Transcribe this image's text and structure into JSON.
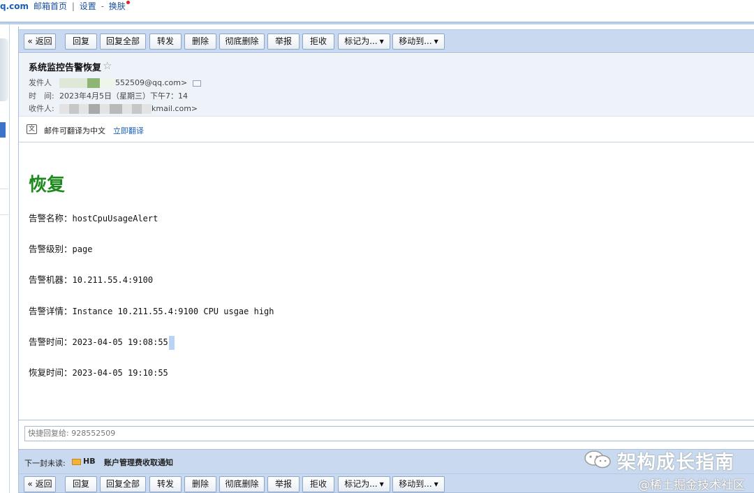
{
  "topbar": {
    "logo_fragment": "q.com",
    "links": [
      "邮箱首页",
      "设置",
      "换肤"
    ],
    "sep1": "|",
    "sep2": "-"
  },
  "toolbar": {
    "back": "« 返回",
    "reply": "回复",
    "reply_all": "回复全部",
    "forward": "转发",
    "delete": "删除",
    "delete_permanent": "彻底删除",
    "report": "举报",
    "reject": "拒收",
    "mark_as": "标记为...",
    "move_to": "移动到..."
  },
  "email": {
    "subject": "系统监控告警恢复",
    "sender_label": "发件人",
    "sender_visible": "552509@qq.com>",
    "time_label": "时　间:",
    "time_value": "2023年4月5日（星期三）下午7：14",
    "recipient_label": "收件人:",
    "recipient_visible": "kmail.com>",
    "translate_text": "邮件可翻译为中文",
    "translate_link": "立即翻译"
  },
  "body": {
    "heading": "恢复",
    "rows": [
      {
        "key": "告警名称：",
        "value": "hostCpuUsageAlert"
      },
      {
        "key": "告警级别：",
        "value": "page"
      },
      {
        "key": "告警机器：",
        "value": "10.211.55.4:9100"
      },
      {
        "key": "告警详情：",
        "value": "Instance 10.211.55.4:9100 CPU usgae high"
      },
      {
        "key": "告警时间：",
        "value": "2023-04-05 19:08:55"
      },
      {
        "key": "恢复时间：",
        "value": "2023-04-05 19:10:55"
      }
    ]
  },
  "quick_reply": {
    "placeholder": "快捷回复给: 928552509"
  },
  "next_unread": {
    "label": "下一封未读:",
    "tag": "HB",
    "subject": "账户管理费收取通知"
  },
  "watermark": {
    "title": "架构成长指南",
    "subtitle": "@稀土掘金技术社区"
  },
  "colors": {
    "heading_green": "#1e8a1e",
    "toolbar_bg": "#c9daf0",
    "link_blue": "#1a5fb4"
  }
}
